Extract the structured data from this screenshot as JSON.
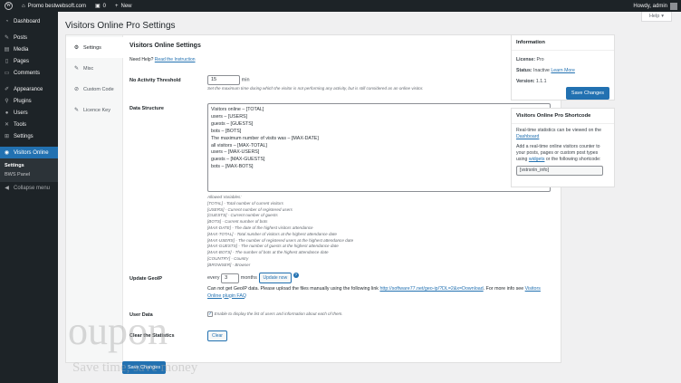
{
  "adminbar": {
    "site_name": "Promo bestwebsoft.com",
    "comments_count": "0",
    "new_label": "New",
    "howdy": "Howdy, admin"
  },
  "sidebar": {
    "items": [
      {
        "label": "Dashboard",
        "icon": "dashboard-icon"
      },
      {
        "label": "Posts",
        "icon": "pin-icon"
      },
      {
        "label": "Media",
        "icon": "media-icon"
      },
      {
        "label": "Pages",
        "icon": "pages-icon"
      },
      {
        "label": "Comments",
        "icon": "comment-icon"
      },
      {
        "label": "Appearance",
        "icon": "brush-icon"
      },
      {
        "label": "Plugins",
        "icon": "plugin-icon"
      },
      {
        "label": "Users",
        "icon": "user-icon"
      },
      {
        "label": "Tools",
        "icon": "wrench-icon"
      },
      {
        "label": "Settings",
        "icon": "settings-icon"
      },
      {
        "label": "Visitors Online",
        "icon": "eye-icon"
      }
    ],
    "submenu": [
      "Settings",
      "BWS Panel"
    ],
    "collapse": "Collapse menu"
  },
  "header": {
    "title": "Visitors Online Pro Settings",
    "help": "Help"
  },
  "tabs": [
    {
      "label": "Settings",
      "icon": "gear-icon"
    },
    {
      "label": "Misc",
      "icon": "wrench-icon"
    },
    {
      "label": "Custom Code",
      "icon": "code-icon"
    },
    {
      "label": "Licence Key",
      "icon": "key-icon"
    }
  ],
  "settings": {
    "section_title": "Visitors Online Settings",
    "need_help": "Need Help?",
    "instruction_link": "Read the Instruction",
    "no_activity_label": "No Activity Threshold",
    "no_activity_value": "15",
    "no_activity_unit": "min",
    "no_activity_desc": "Set the maximum time during which the visitor is not performing any activity, but is still considered as an online visitor.",
    "structure_label": "Data Structure",
    "structure_text": "Visitors online – [TOTAL]\nusers – [USERS]\nguests – [GUESTS]\nbots – [BOTS]\nThe maximum number of visits was – [MAX-DATE]\nall visitors – [MAX-TOTAL]\nusers – [MAX-USERS]\nguests – [MAX-GUESTS]\nbots – [MAX-BOTS]",
    "allowed_title": "Allowed Variables:",
    "allowed": [
      "[TOTAL] - Total number of current visitors",
      "[USERS] - Current number of registered users",
      "[GUESTS] - Current number of guests",
      "[BOTS] - Current number of bots",
      "[MAX-DATE] - The date of the highest visitors attendance",
      "[MAX-TOTAL] - Total number of visitors at the highest attendance date",
      "[MAX-USERS] - The number of registered users at the highest attendance date",
      "[MAX-GUESTS] - The number of guests at the highest attendance date",
      "[MAX-BOTS] - The number of bots at the highest attendance date",
      "[COUNTRY] - Country",
      "[BROWSER] - Browser"
    ],
    "geoip_label": "Update GeoIP",
    "geoip_every": "every",
    "geoip_value": "3",
    "geoip_months": "months",
    "geoip_button": "Update now",
    "geoip_msg": "Can not get GeoIP data. Please upload the files manually using the following link",
    "geoip_link": "http://software77.net/geo-ip/?DL=2&x=Download",
    "geoip_more": ". For more info see",
    "geoip_faq": "Visitors Online plugin FAQ",
    "userdata_label": "User Data",
    "userdata_check": "Enable to display the list of users and information about each of them.",
    "clear_label": "Clear the Statistics",
    "clear_button": "Clear",
    "save_button": "Save Changes"
  },
  "info_box": {
    "title": "Information",
    "license_label": "License:",
    "license_value": "Pro",
    "status_label": "Status:",
    "status_value": "Inactive",
    "learn_more": "Learn More",
    "version_label": "Version:",
    "version_value": "1.1.1",
    "save_button": "Save Changes"
  },
  "shortcode_box": {
    "title": "Visitors Online Pro Shortcode",
    "text1": "Real-time statistics can be viewed on the",
    "dashboard_link": "Dashboard",
    "text2": "Add a real-time online visitors counter to your posts, pages or custom post types using",
    "widgets_link": "widgets",
    "text3": "or the following shortcode:",
    "shortcode": "[vstrsnln_info]"
  },
  "watermark": {
    "brand": "oupon",
    "tagline": "Save time, save money"
  }
}
